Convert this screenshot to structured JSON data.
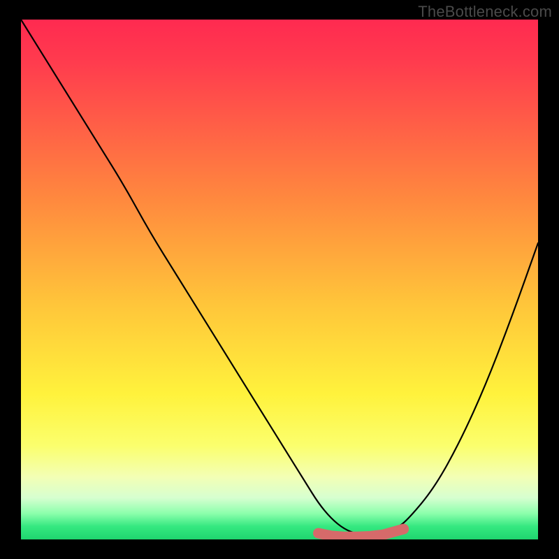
{
  "watermark": "TheBottleneck.com",
  "chart_data": {
    "type": "line",
    "title": "",
    "xlabel": "",
    "ylabel": "",
    "xlim": [
      0,
      1
    ],
    "ylim": [
      0,
      1
    ],
    "x": [
      0.0,
      0.05,
      0.1,
      0.15,
      0.2,
      0.25,
      0.3,
      0.35,
      0.4,
      0.45,
      0.5,
      0.55,
      0.575,
      0.6,
      0.625,
      0.65,
      0.675,
      0.7,
      0.725,
      0.75,
      0.8,
      0.85,
      0.9,
      0.95,
      1.0
    ],
    "values": [
      1.0,
      0.92,
      0.84,
      0.76,
      0.68,
      0.59,
      0.51,
      0.43,
      0.35,
      0.27,
      0.19,
      0.11,
      0.07,
      0.04,
      0.02,
      0.01,
      0.01,
      0.01,
      0.02,
      0.04,
      0.1,
      0.19,
      0.3,
      0.43,
      0.57
    ],
    "markers": {
      "color": "#d66a6a",
      "points": [
        {
          "x": 0.575,
          "y": 0.012
        },
        {
          "x": 0.6,
          "y": 0.007
        },
        {
          "x": 0.625,
          "y": 0.005
        },
        {
          "x": 0.65,
          "y": 0.005
        },
        {
          "x": 0.675,
          "y": 0.006
        },
        {
          "x": 0.7,
          "y": 0.009
        },
        {
          "x": 0.74,
          "y": 0.02
        }
      ]
    },
    "gradient_stops": [
      {
        "pos": 0.0,
        "color": "#ff2a50"
      },
      {
        "pos": 0.55,
        "color": "#ffe63a"
      },
      {
        "pos": 0.9,
        "color": "#d8ffb8"
      },
      {
        "pos": 1.0,
        "color": "#1fd56f"
      }
    ]
  }
}
